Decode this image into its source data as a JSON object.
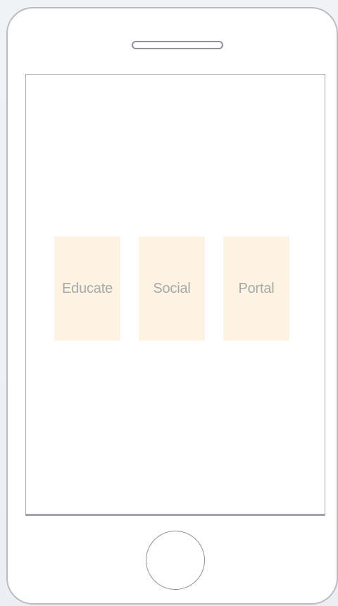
{
  "apps": [
    {
      "label": "Educate",
      "color": "#fdf3e2"
    },
    {
      "label": "Social",
      "color": "#fdf3e2"
    },
    {
      "label": "Portal",
      "color": "#fdf3e2"
    }
  ],
  "colors": {
    "tile": "#fdf3e2",
    "label": "#a8a8a8",
    "device_outline": "#b9bcc3",
    "background": "#eef0f5"
  }
}
